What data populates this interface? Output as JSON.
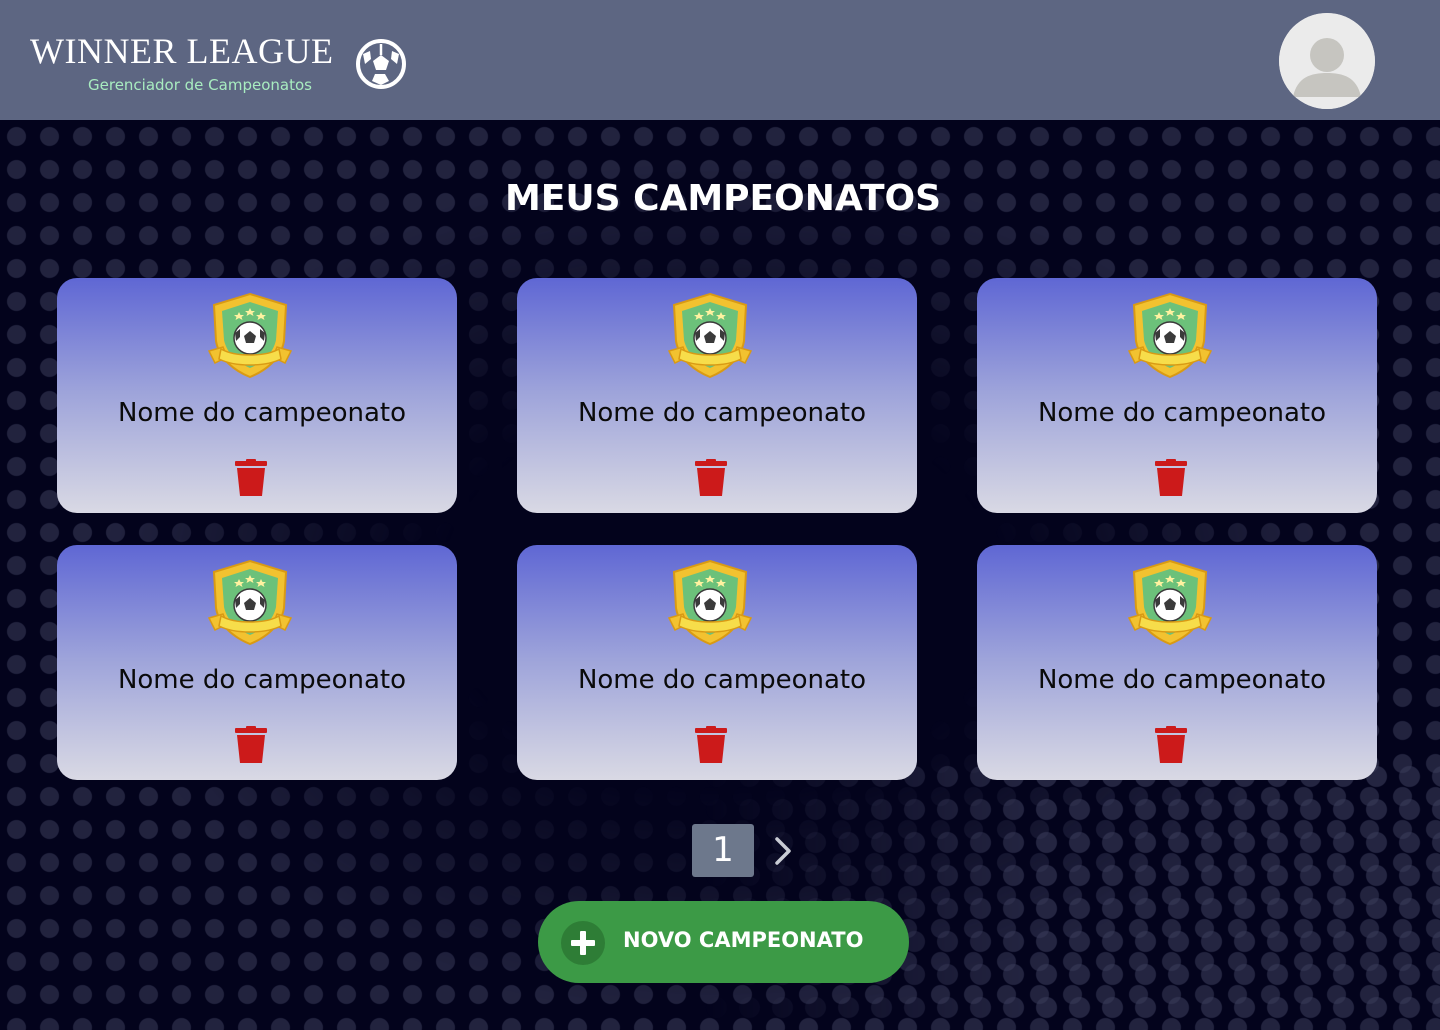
{
  "header": {
    "brand_title": "WINNER LEAGUE",
    "brand_subtitle": "Gerenciador de Campeonatos",
    "brand_icon": "soccer-ball-icon",
    "avatar_icon": "user-avatar-icon"
  },
  "main": {
    "title": "MEUS CAMPEONATOS",
    "cards": [
      {
        "name": "Nome do campeonato",
        "icon": "championship-crest-icon",
        "action_icon": "trash-icon"
      },
      {
        "name": "Nome do campeonato",
        "icon": "championship-crest-icon",
        "action_icon": "trash-icon"
      },
      {
        "name": "Nome do campeonato",
        "icon": "championship-crest-icon",
        "action_icon": "trash-icon"
      },
      {
        "name": "Nome do campeonato",
        "icon": "championship-crest-icon",
        "action_icon": "trash-icon"
      },
      {
        "name": "Nome do campeonato",
        "icon": "championship-crest-icon",
        "action_icon": "trash-icon"
      },
      {
        "name": "Nome do campeonato",
        "icon": "championship-crest-icon",
        "action_icon": "trash-icon"
      }
    ]
  },
  "pagination": {
    "current_page": "1",
    "next_icon": "chevron-right-icon"
  },
  "actions": {
    "new_label": "NOVO CAMPEONATO",
    "new_icon": "plus-circle-icon"
  },
  "colors": {
    "header_bg": "#5d6682",
    "page_bg": "#03031c",
    "card_gradient_top": "#5f67d4",
    "card_gradient_bottom": "#d9d9e4",
    "trash": "#cc1a1a",
    "primary_button": "#3c9a46",
    "subtitle_text": "#a8ecc0"
  }
}
